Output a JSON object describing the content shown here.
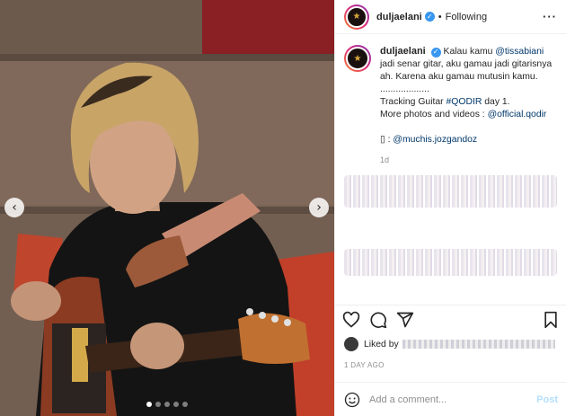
{
  "post": {
    "username": "duljaelani",
    "verified_glyph": "✓",
    "separator": "•",
    "follow_status": "Following",
    "more_glyph": "···"
  },
  "caption": {
    "username": "duljaelani",
    "line1_prefix": "Kalau kamu ",
    "mention1": "@tissabiani",
    "line1_suffix": " jadi senar gitar, aku gamau jadi gitarisnya ah. Karena aku gamau mutusin kamu.",
    "dots": "...................",
    "line2_prefix": "Tracking Guitar ",
    "hashtag": "#QODIR",
    "line2_suffix": " day 1.",
    "line3_prefix": "More photos and videos : ",
    "mention2": "@official.qodir",
    "camera_glyph": "▯",
    "line4_sep": " : ",
    "mention3": "@muchis.jozgandoz",
    "time": "1d"
  },
  "likes": {
    "prefix": "Liked by"
  },
  "date": "1 DAY AGO",
  "comment_box": {
    "placeholder": "Add a comment...",
    "post_label": "Post",
    "emoji_icon": "smiley-icon"
  },
  "media": {
    "prev_glyph": "‹",
    "next_glyph": "›",
    "dot_count": 5,
    "active_dot": 0
  },
  "colors": {
    "link": "#00376b",
    "verified": "#3897f0",
    "post_button": "#b2dffc"
  }
}
